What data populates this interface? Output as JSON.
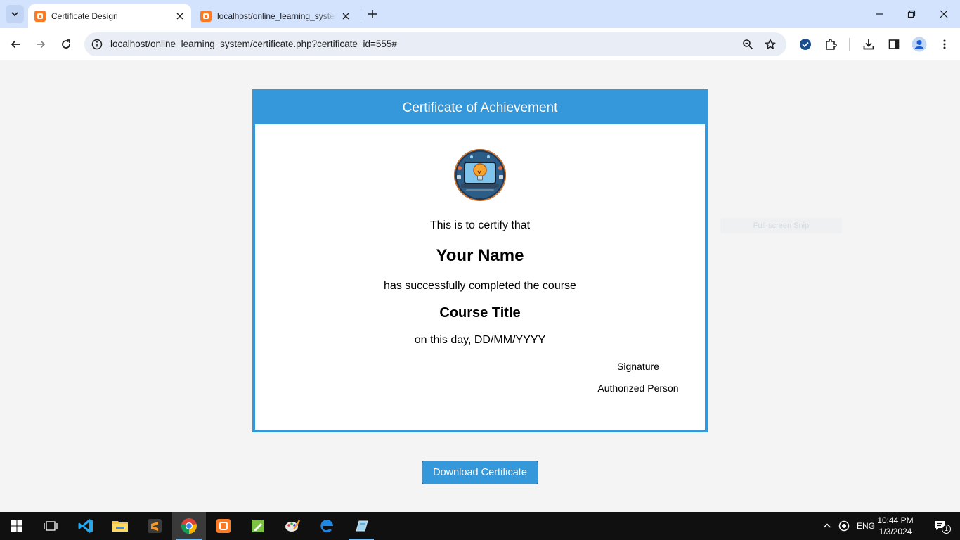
{
  "browser": {
    "tabs": [
      {
        "title": "Certificate Design",
        "active": true
      },
      {
        "title": "localhost/online_learning_system/certificate.php",
        "active": false
      }
    ],
    "url": "localhost/online_learning_system/certificate.php?certificate_id=555#"
  },
  "certificate": {
    "header": "Certificate of Achievement",
    "certify_text": "This is to certify that",
    "name": "Your Name",
    "completed_text": "has successfully completed the course",
    "course_title": "Course Title",
    "date_text": "on this day, DD/MM/YYYY",
    "signature": "Signature",
    "authorized": "Authorized Person"
  },
  "download_button": "Download Certificate",
  "snip_overlay": "Full-screen Snip",
  "taskbar": {
    "language": "ENG",
    "time": "10:44 PM",
    "date": "1/3/2024",
    "notification_count": "1"
  },
  "colors": {
    "accent": "#3498db",
    "tab_strip": "#d3e3fd",
    "taskbar": "#101010"
  }
}
